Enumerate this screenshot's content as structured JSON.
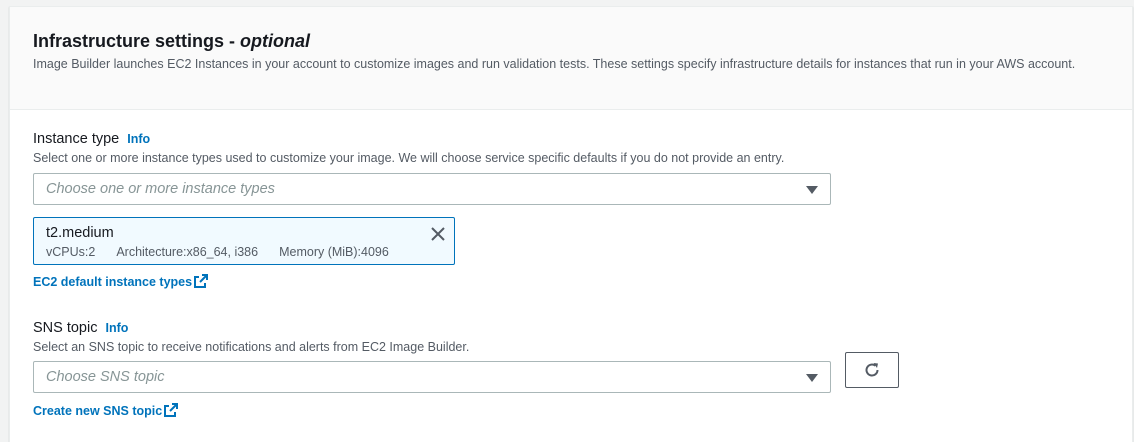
{
  "section": {
    "title": "Infrastructure settings - ",
    "title_optional": "optional",
    "description": "Image Builder launches EC2 Instances in your account to customize images and run validation tests. These settings specify infrastructure details for instances that run in your AWS account."
  },
  "instance_type": {
    "label": "Instance type",
    "info": "Info",
    "hint": "Select one or more instance types used to customize your image. We will choose service specific defaults if you do not provide an entry.",
    "placeholder": "Choose one or more instance types",
    "selected": [
      {
        "name": "t2.medium",
        "vcpus": "vCPUs:2",
        "architecture": "Architecture:x86_64, i386",
        "memory": "Memory (MiB):4096"
      }
    ],
    "link": "EC2 default instance types"
  },
  "sns_topic": {
    "label": "SNS topic",
    "info": "Info",
    "hint": "Select an SNS topic to receive notifications and alerts from EC2 Image Builder.",
    "placeholder": "Choose SNS topic",
    "link": "Create new SNS topic"
  },
  "icons": {
    "caret": "caret-down-icon",
    "close": "close-icon",
    "external": "external-link-icon",
    "refresh": "refresh-icon"
  },
  "colors": {
    "link": "#0073bb",
    "token_border": "#0073bb",
    "token_bg": "#f1faff"
  }
}
